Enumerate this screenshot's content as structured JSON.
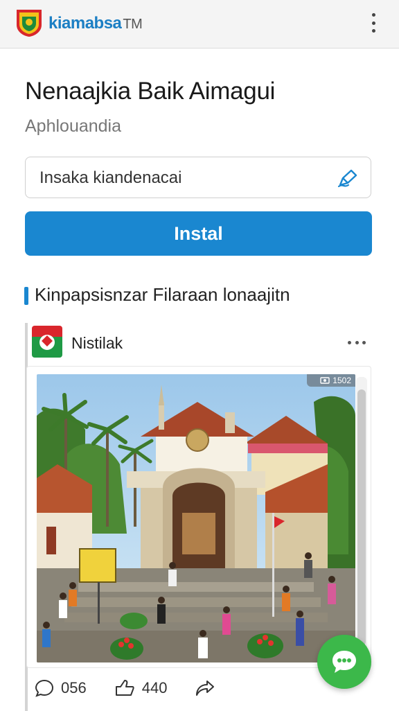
{
  "app": {
    "brand": "kiamabsa",
    "brand_tm": "TM"
  },
  "header": {
    "title": "Nenaajkia Baik Aimagui",
    "subtitle": "Aphlouandia"
  },
  "search": {
    "value": "Insaka kiandenacai",
    "icon": "edit-pen-icon"
  },
  "install": {
    "label": "Instal"
  },
  "section": {
    "title": "Kinpapsisnzar Filaraan lonaajitn"
  },
  "post": {
    "author": "Nistilak",
    "image_badge": "1502",
    "stats": {
      "comments": "056",
      "likes": "440"
    }
  },
  "colors": {
    "accent": "#1a87d0",
    "fab": "#3cb84a",
    "brand_text": "#1c7fc4"
  }
}
